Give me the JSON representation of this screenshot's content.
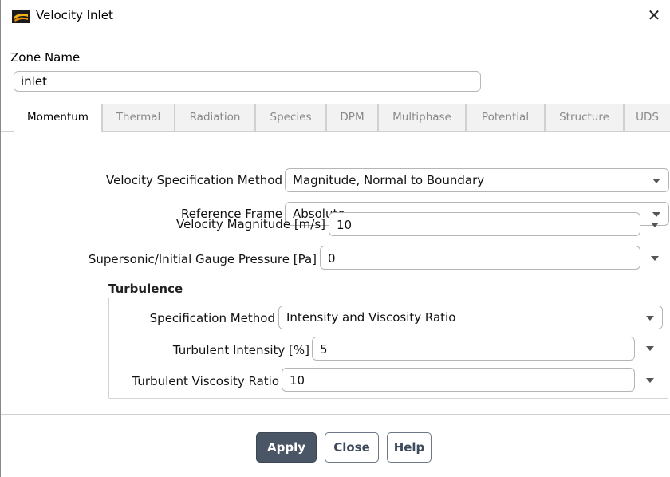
{
  "window": {
    "title": "Velocity Inlet",
    "close_glyph": "✕",
    "icon": "fluent-app-icon"
  },
  "zone": {
    "label": "Zone Name",
    "value": "inlet"
  },
  "tabs": [
    {
      "label": "Momentum",
      "active": true
    },
    {
      "label": "Thermal",
      "active": false
    },
    {
      "label": "Radiation",
      "active": false
    },
    {
      "label": "Species",
      "active": false
    },
    {
      "label": "DPM",
      "active": false
    },
    {
      "label": "Multiphase",
      "active": false
    },
    {
      "label": "Potential",
      "active": false
    },
    {
      "label": "Structure",
      "active": false
    },
    {
      "label": "UDS",
      "active": false
    }
  ],
  "momentum": {
    "velocity_spec": {
      "label": "Velocity Specification Method",
      "value": "Magnitude, Normal to Boundary"
    },
    "reference_frame": {
      "label": "Reference Frame",
      "value": "Absolute"
    },
    "velocity_magnitude": {
      "label": "Velocity Magnitude [m/s]",
      "value": "10"
    },
    "gauge_pressure": {
      "label": "Supersonic/Initial Gauge Pressure [Pa]",
      "value": "0"
    }
  },
  "turbulence": {
    "title": "Turbulence",
    "spec_method": {
      "label": "Specification Method",
      "value": "Intensity and Viscosity Ratio"
    },
    "intensity": {
      "label": "Turbulent Intensity [%]",
      "value": "5"
    },
    "viscosity_ratio": {
      "label": "Turbulent Viscosity Ratio",
      "value": "10"
    }
  },
  "buttons": {
    "apply": "Apply",
    "close": "Close",
    "help": "Help"
  },
  "colors": {
    "primary_button": "#4a5565",
    "secondary_button_text": "#3d4a5c"
  }
}
